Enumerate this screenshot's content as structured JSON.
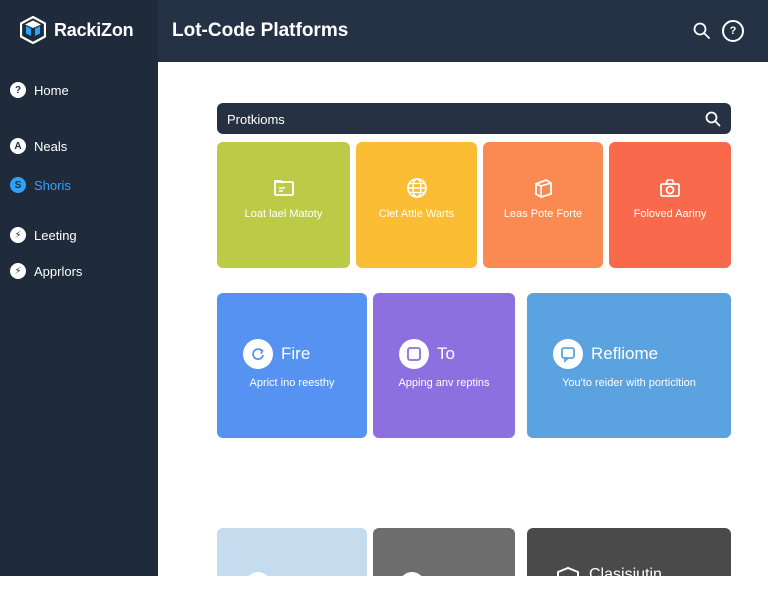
{
  "brand": {
    "name": "RackiZon",
    "logo_icon": "cube-logo-icon"
  },
  "sidebar": {
    "items": [
      {
        "label": "Home",
        "icon": "home-icon",
        "glyph": "?"
      },
      {
        "label": "Neals",
        "icon": "user-icon",
        "glyph": "A"
      },
      {
        "label": "Shoris",
        "icon": "shorts-icon",
        "glyph": "S",
        "active": true
      },
      {
        "label": "Leeting",
        "icon": "lightning-icon",
        "glyph": "⚡"
      },
      {
        "label": "Apprlors",
        "icon": "lightning-icon",
        "glyph": "⚡"
      }
    ]
  },
  "header": {
    "title": "Lot-Code Platforms",
    "search_icon": "search-icon",
    "help_glyph": "?"
  },
  "search": {
    "placeholder": "Protkioms"
  },
  "cards_row1": [
    {
      "label": "Loat lael Matoty",
      "icon": "folder-icon",
      "color": "#bbcb47"
    },
    {
      "label": "Clet Attle Warts",
      "icon": "globe-icon",
      "color": "#fbbd34"
    },
    {
      "label": "Leas Pote Forte",
      "icon": "box-icon",
      "color": "#fa8a52"
    },
    {
      "label": "Foloved Aariny",
      "icon": "camera-icon",
      "color": "#f96a4d"
    }
  ],
  "cards_row2": [
    {
      "title": "Fire",
      "subtitle": "Aprict ino reesthy",
      "icon": "refresh-icon",
      "color": "#5592f2"
    },
    {
      "title": "To",
      "subtitle": "Apping anv reptins",
      "icon": "square-icon",
      "color": "#8d6fe0"
    },
    {
      "title": "Refliome",
      "subtitle": "You'to reider with porticltion",
      "icon": "chat-icon",
      "color": "#5aa2e0"
    }
  ],
  "cards_row3": [
    {
      "color": "#c5dcee"
    },
    {
      "color": "#6d6d6d"
    },
    {
      "color": "#4a4a4a",
      "text": "Clasisiutin"
    }
  ],
  "colors": {
    "sidebar": "#1f2a3a",
    "header": "#253246",
    "accent": "#2aa5ff"
  }
}
